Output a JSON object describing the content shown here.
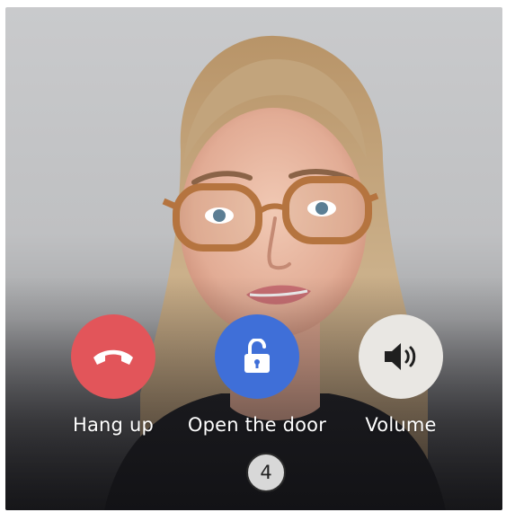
{
  "call": {
    "countdown": "4"
  },
  "controls": {
    "hangup": {
      "label": "Hang up",
      "icon": "phone-hangup-icon",
      "color": "#e2555a"
    },
    "door": {
      "label": "Open the door",
      "icon": "unlock-icon",
      "color": "#3f6fd8"
    },
    "volume": {
      "label": "Volume",
      "icon": "speaker-icon",
      "color": "#e9e7e3"
    }
  },
  "colors": {
    "text": "#ffffff",
    "countdown_bg": "#d8d8d8"
  }
}
